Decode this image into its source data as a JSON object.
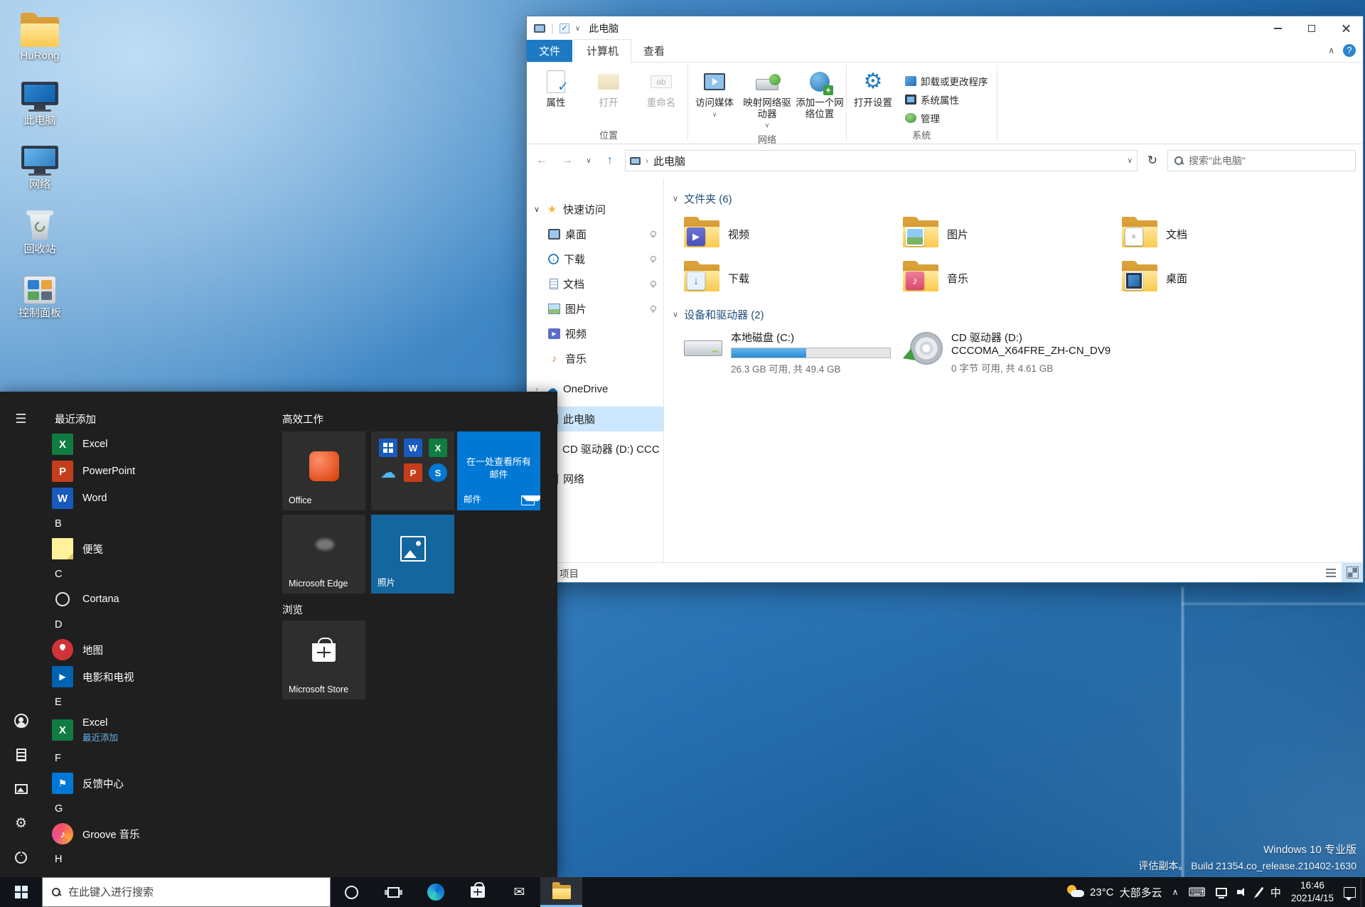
{
  "glyphs": {
    "menu": "☰",
    "back": "←",
    "forward": "→",
    "up": "↑",
    "refresh": "↻",
    "chev_down": "∨",
    "chev_up": "∧",
    "chev_right": "›",
    "star": "★",
    "cloud": "☁",
    "note": "♪",
    "play": "▶",
    "gear": "⚙",
    "check": "✓",
    "mail": "✉",
    "keyboard": "⌨",
    "flag": "⚑",
    "help": "?",
    "dash": "·"
  },
  "desktop": {
    "icons": [
      {
        "label": "HuRong"
      },
      {
        "label": "此电脑"
      },
      {
        "label": "网络"
      },
      {
        "label": "回收站"
      },
      {
        "label": "控制面板"
      }
    ],
    "watermark": {
      "line1": "Windows 10 专业版",
      "line2": "评估副本。   Build 21354.co_release.210402-1630"
    }
  },
  "explorer": {
    "title": "此电脑",
    "tabs": {
      "file": "文件",
      "computer": "计算机",
      "view": "查看"
    },
    "ribbon": {
      "location_group": {
        "label": "位置",
        "properties": "属性",
        "open": "打开",
        "rename": "重命名"
      },
      "network_group": {
        "label": "网络",
        "access_media": "访问媒体",
        "map_drive": "映射网络驱动器",
        "add_location": "添加一个网络位置"
      },
      "system_group": {
        "label": "系统",
        "open_settings": "打开设置",
        "uninstall": "卸载或更改程序",
        "system_props": "系统属性",
        "manage": "管理"
      }
    },
    "address": {
      "breadcrumb": "此电脑",
      "search_placeholder": "搜索\"此电脑\""
    },
    "nav": {
      "quick_access": "快速访问",
      "items": [
        {
          "label": "桌面"
        },
        {
          "label": "下载"
        },
        {
          "label": "文档"
        },
        {
          "label": "图片"
        },
        {
          "label": "视频"
        },
        {
          "label": "音乐"
        }
      ],
      "onedrive": "OneDrive",
      "this_pc": "此电脑",
      "cd_drive": "CD 驱动器 (D:) CCC",
      "network": "网络"
    },
    "folders_section": {
      "title": "文件夹 (6)",
      "items": [
        {
          "label": "视频"
        },
        {
          "label": "图片"
        },
        {
          "label": "文档"
        },
        {
          "label": "下载"
        },
        {
          "label": "音乐"
        },
        {
          "label": "桌面"
        }
      ]
    },
    "drives_section": {
      "title": "设备和驱动器 (2)",
      "disk_c": {
        "label": "本地磁盘 (C:)",
        "detail": "26.3 GB 可用, 共 49.4 GB",
        "used_percent": 47
      },
      "cd": {
        "label": "CD 驱动器 (D:) CCCOMA_X64FRE_ZH-CN_DV9",
        "detail": "0 字节 可用, 共 4.61 GB"
      }
    },
    "statusbar": {
      "items_label": "项目"
    }
  },
  "start_menu": {
    "headers": {
      "recent": "最近添加",
      "b": "B",
      "c": "C",
      "d": "D",
      "e": "E",
      "f": "F",
      "g": "G",
      "h": "H"
    },
    "apps": {
      "excel": "Excel",
      "powerpoint": "PowerPoint",
      "word": "Word",
      "sticky_notes": "便笺",
      "cortana": "Cortana",
      "maps": "地图",
      "movies_tv": "电影和电视",
      "excel2": "Excel",
      "excel2_sub": "最近添加",
      "feedback": "反馈中心",
      "groove": "Groove 音乐"
    },
    "groups": {
      "productivity": "高效工作",
      "explore": "浏览"
    },
    "tiles": {
      "office": "Office",
      "mail_caption": "在一处查看所有邮件",
      "mail": "邮件",
      "edge": "Microsoft Edge",
      "photos": "照片",
      "store": "Microsoft Store"
    },
    "icon_letters": {
      "word": "W",
      "excel": "X",
      "powerpoint": "P",
      "skype": "S"
    }
  },
  "taskbar": {
    "search_placeholder": "在此键入进行搜索",
    "tray": {
      "temp": "23°C",
      "condition": "大部多云",
      "ime": "中",
      "time": "16:46",
      "date": "2021/4/15"
    }
  }
}
